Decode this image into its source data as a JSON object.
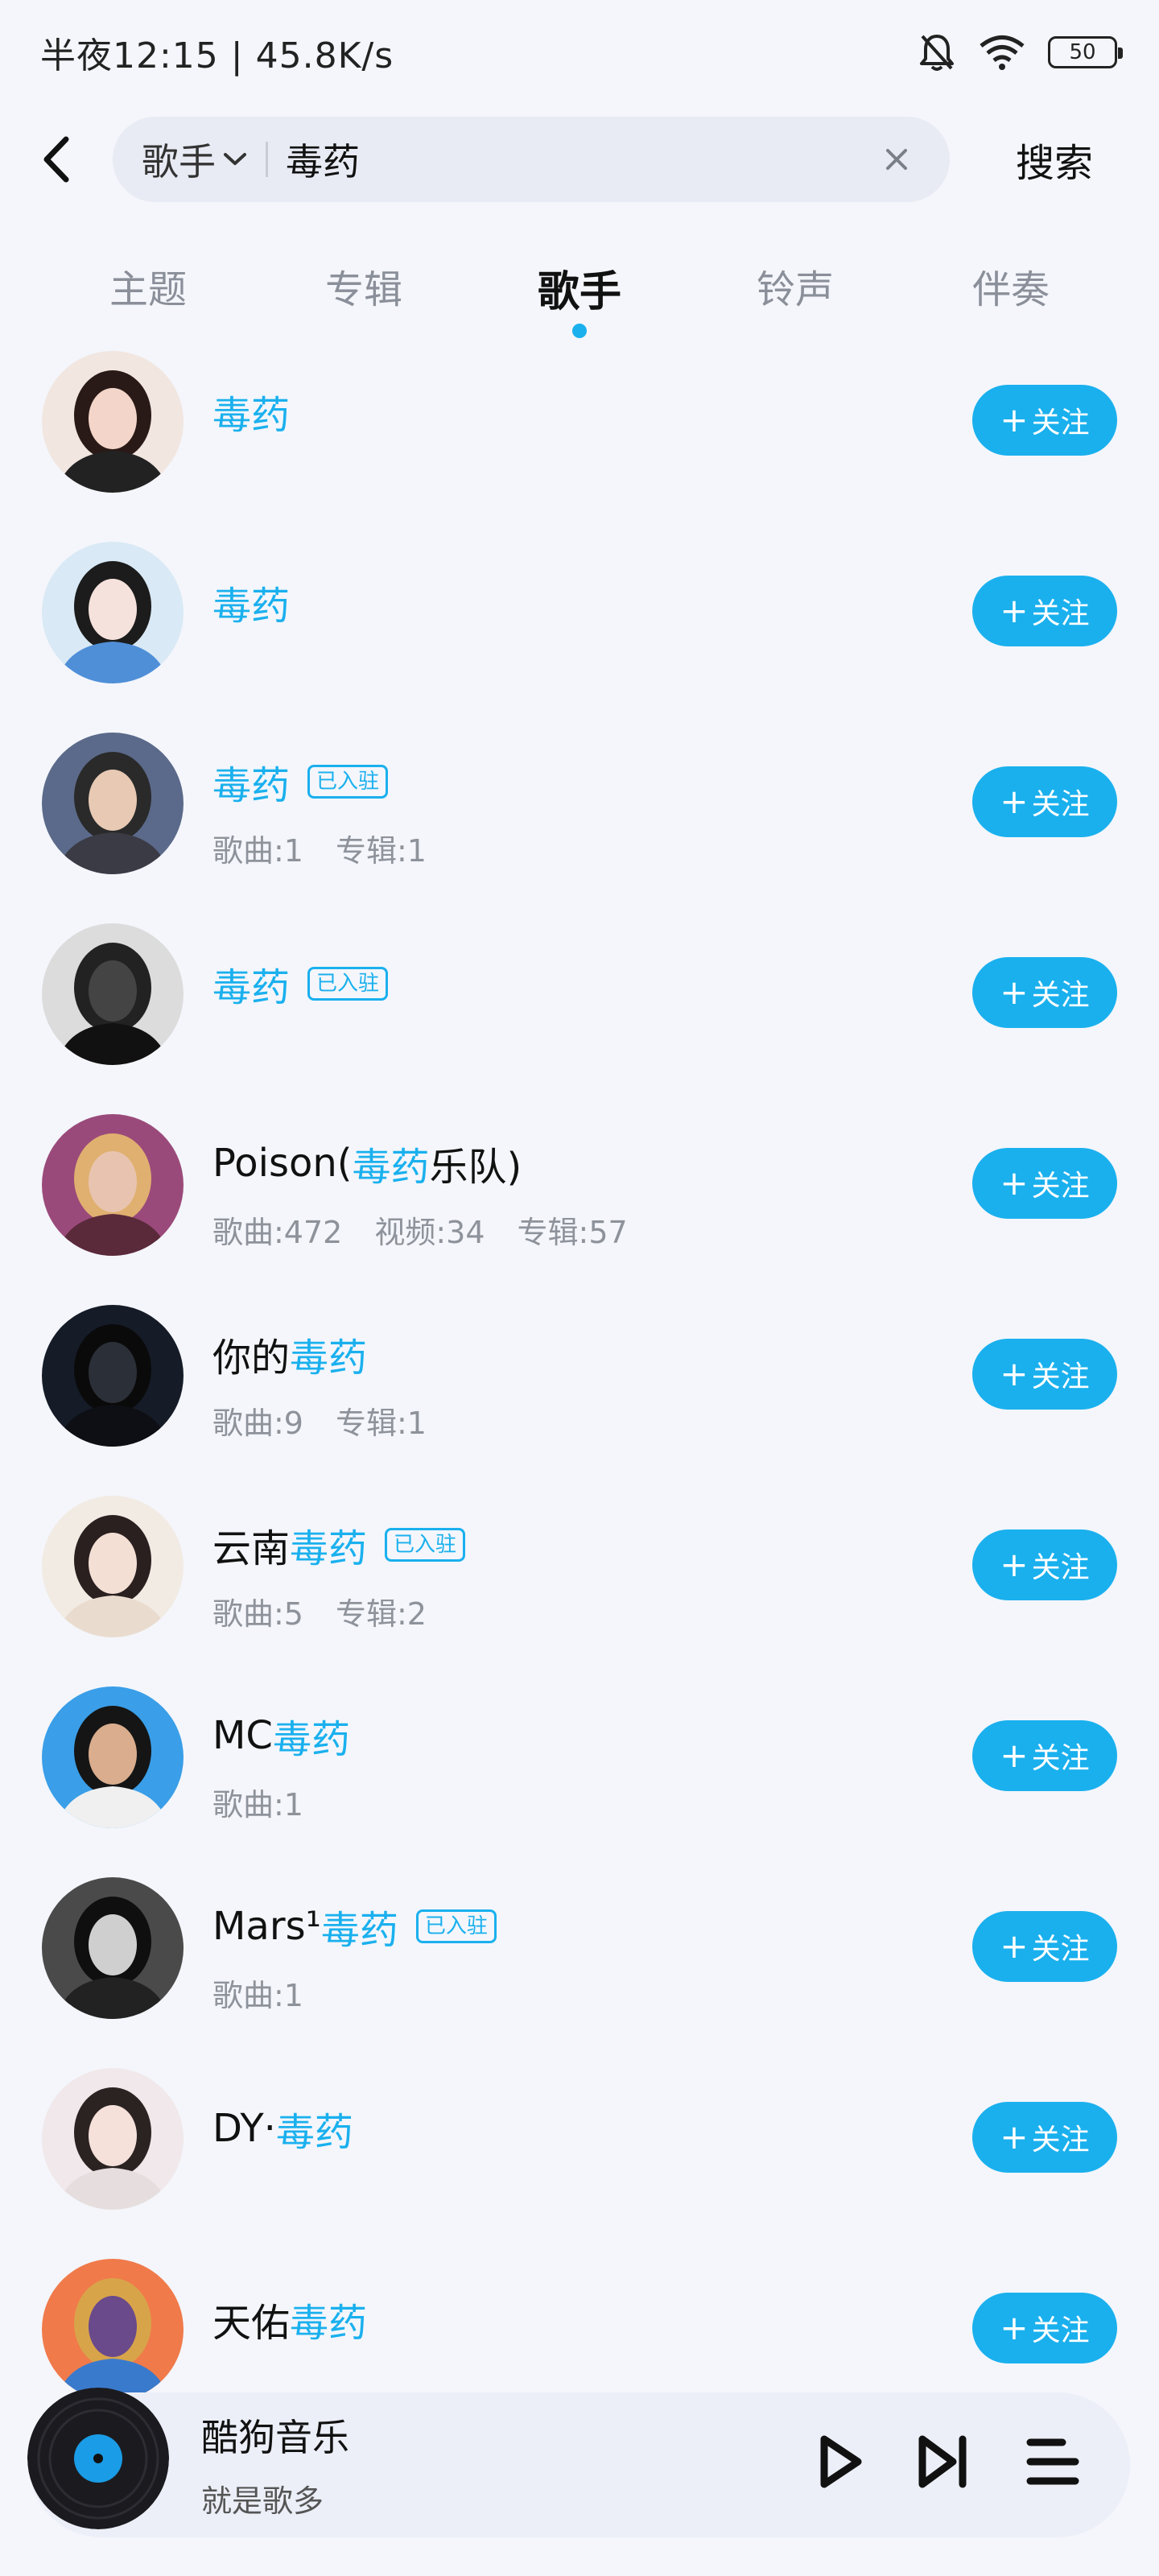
{
  "status_bar": {
    "time": "半夜12:15 | 45.8K/s",
    "battery": "50",
    "icons": [
      "bell-muted-icon",
      "wifi-icon",
      "battery-icon"
    ]
  },
  "header": {
    "search_type": "歌手",
    "search_value": "毒药",
    "search_button": "搜索"
  },
  "tabs": [
    {
      "label": "主题",
      "active": false
    },
    {
      "label": "专辑",
      "active": false
    },
    {
      "label": "歌手",
      "active": true
    },
    {
      "label": "铃声",
      "active": false
    },
    {
      "label": "伴奏",
      "active": false
    }
  ],
  "follow_label": "关注",
  "badge_label": "已入驻",
  "artists": [
    {
      "prefix": "",
      "highlight": "毒药",
      "suffix": "",
      "badge": false,
      "stats": []
    },
    {
      "prefix": "",
      "highlight": "毒药",
      "suffix": "",
      "badge": false,
      "stats": []
    },
    {
      "prefix": "",
      "highlight": "毒药",
      "suffix": "",
      "badge": true,
      "stats": [
        "歌曲:1",
        "专辑:1"
      ]
    },
    {
      "prefix": "",
      "highlight": "毒药",
      "suffix": "",
      "badge": true,
      "stats": []
    },
    {
      "prefix": "Poison(",
      "highlight": "毒药",
      "suffix": "乐队)",
      "badge": false,
      "stats": [
        "歌曲:472",
        "视频:34",
        "专辑:57"
      ]
    },
    {
      "prefix": "你的",
      "highlight": "毒药",
      "suffix": "",
      "badge": false,
      "stats": [
        "歌曲:9",
        "专辑:1"
      ]
    },
    {
      "prefix": "云南",
      "highlight": "毒药",
      "suffix": "",
      "badge": true,
      "stats": [
        "歌曲:5",
        "专辑:2"
      ]
    },
    {
      "prefix": "MC",
      "highlight": "毒药",
      "suffix": "",
      "badge": false,
      "stats": [
        "歌曲:1"
      ]
    },
    {
      "prefix": "Mars¹",
      "highlight": "毒药",
      "suffix": "",
      "badge": true,
      "stats": [
        "歌曲:1"
      ]
    },
    {
      "prefix": "DY·",
      "highlight": "毒药",
      "suffix": "",
      "badge": false,
      "stats": []
    },
    {
      "prefix": "天佑",
      "highlight": "毒药",
      "suffix": "",
      "badge": false,
      "stats": []
    }
  ],
  "player": {
    "title": "酷狗音乐",
    "subtitle": "就是歌多"
  },
  "colors": {
    "accent": "#1ab0ee",
    "background": "#f4f6fb"
  }
}
